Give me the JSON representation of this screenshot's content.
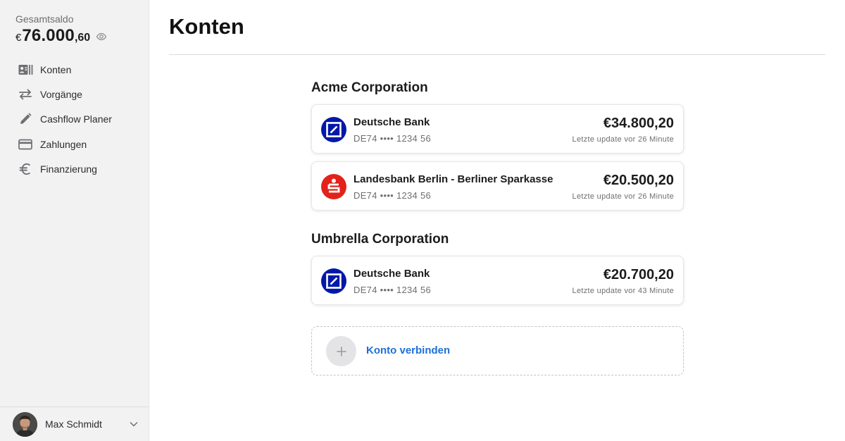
{
  "sidebar": {
    "balance_label": "Gesamtsaldo",
    "balance_currency": "€",
    "balance_main": "76.000",
    "balance_cents": ",60",
    "nav": [
      {
        "label": "Konten",
        "icon": "accounts-icon"
      },
      {
        "label": "Vorgänge",
        "icon": "transfer-arrows-icon"
      },
      {
        "label": "Cashflow Planer",
        "icon": "pencil-icon"
      },
      {
        "label": "Zahlungen",
        "icon": "credit-card-icon"
      },
      {
        "label": "Finanzierung",
        "icon": "euro-icon"
      }
    ],
    "user": {
      "name": "Max Schmidt"
    }
  },
  "main": {
    "title": "Konten",
    "groups": [
      {
        "name": "Acme Corporation",
        "accounts": [
          {
            "bank": "Deutsche Bank",
            "iban": "DE74 •••• 1234 56",
            "amount": "€34.800,20",
            "updated": "Letzte update vor 26 Minute",
            "logo": "deutsche-bank-logo"
          },
          {
            "bank": "Landesbank Berlin - Berliner Sparkasse",
            "iban": "DE74 •••• 1234 56",
            "amount": "€20.500,20",
            "updated": "Letzte update vor 26 Minute",
            "logo": "sparkasse-logo"
          }
        ]
      },
      {
        "name": "Umbrella Corporation",
        "accounts": [
          {
            "bank": "Deutsche Bank",
            "iban": "DE74 •••• 1234 56",
            "amount": "€20.700,20",
            "updated": "Letzte update vor 43 Minute",
            "logo": "deutsche-bank-logo"
          }
        ]
      }
    ],
    "connect_label": "Konto verbinden"
  },
  "colors": {
    "accent": "#1f6fd6",
    "deutsche_bank": "#0018a8",
    "sparkasse": "#e2231a",
    "sidebar_bg": "#f2f2f2"
  }
}
